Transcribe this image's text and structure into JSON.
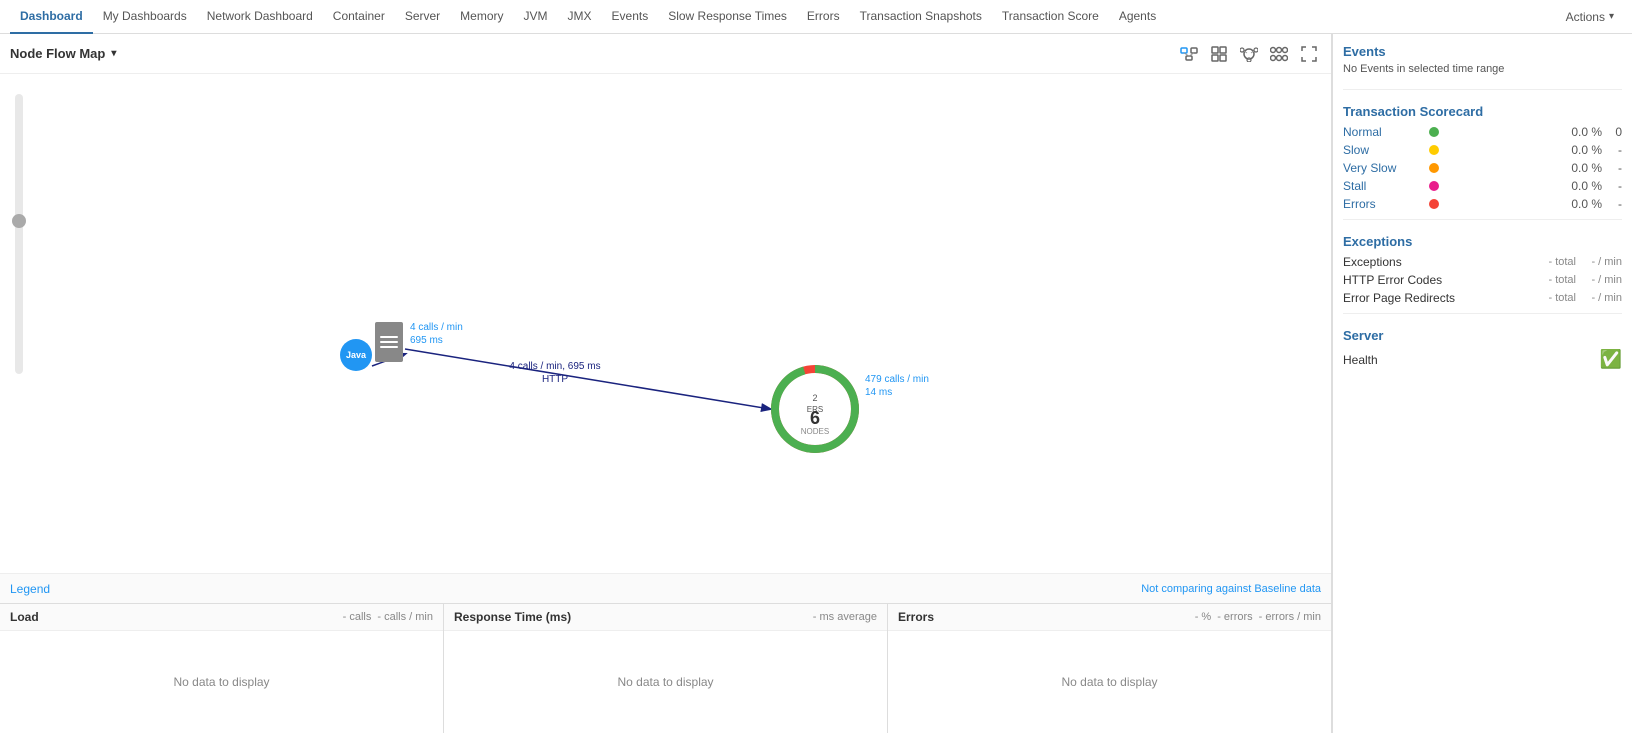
{
  "nav": {
    "tabs": [
      {
        "label": "Dashboard",
        "active": true
      },
      {
        "label": "My Dashboards",
        "active": false
      },
      {
        "label": "Network Dashboard",
        "active": false
      },
      {
        "label": "Container",
        "active": false
      },
      {
        "label": "Server",
        "active": false
      },
      {
        "label": "Memory",
        "active": false
      },
      {
        "label": "JVM",
        "active": false
      },
      {
        "label": "JMX",
        "active": false
      },
      {
        "label": "Events",
        "active": false
      },
      {
        "label": "Slow Response Times",
        "active": false
      },
      {
        "label": "Errors",
        "active": false
      },
      {
        "label": "Transaction Snapshots",
        "active": false
      },
      {
        "label": "Transaction Score",
        "active": false
      },
      {
        "label": "Agents",
        "active": false
      }
    ],
    "actions_label": "Actions"
  },
  "subheader": {
    "title": "Node Flow Map",
    "chevron": "▾"
  },
  "flow_map": {
    "java_node_label": "Java",
    "server_calls_label": "4 calls / min",
    "server_ms_label": "695 ms",
    "arrow_label_1": "4 calls / min, 695 ms",
    "arrow_label_2": "HTTP",
    "center_node": {
      "text_top": "2",
      "text_mid": "ERS",
      "text_num": "6",
      "text_bottom": "NODES"
    },
    "center_calls_label": "479 calls / min",
    "center_ms_label": "14 ms"
  },
  "legend": {
    "label": "Legend",
    "baseline_label": "Not comparing against Baseline data"
  },
  "bottom_panels": {
    "load": {
      "title": "Load",
      "meta_calls": "- calls",
      "meta_calls_min": "- calls / min",
      "no_data": "No data to display"
    },
    "response_time": {
      "title": "Response Time (ms)",
      "meta_avg": "- ms average",
      "no_data": "No data to display"
    },
    "errors": {
      "title": "Errors",
      "meta_pct": "- %",
      "meta_errors": "- errors",
      "meta_rate": "- errors / min",
      "no_data": "No data to display"
    }
  },
  "right_panel": {
    "events_title": "Events",
    "events_text": "No Events in selected time range",
    "scorecard_title": "Transaction Scorecard",
    "scorecard_rows": [
      {
        "label": "Normal",
        "color": "#4caf50",
        "pct": "0.0 %",
        "count": "0",
        "dash": ""
      },
      {
        "label": "Slow",
        "color": "#ffeb3b",
        "pct": "0.0 %",
        "count": "",
        "dash": "-"
      },
      {
        "label": "Very Slow",
        "color": "#ff9800",
        "pct": "0.0 %",
        "count": "",
        "dash": "-"
      },
      {
        "label": "Stall",
        "color": "#e91e8c",
        "pct": "0.0 %",
        "count": "",
        "dash": "-"
      },
      {
        "label": "Errors",
        "color": "#f44336",
        "pct": "0.0 %",
        "count": "",
        "dash": "-"
      }
    ],
    "exceptions_title": "Exceptions",
    "exceptions_rows": [
      {
        "label": "Exceptions",
        "total": "- total",
        "rate": "- / min"
      },
      {
        "label": "HTTP Error Codes",
        "total": "- total",
        "rate": "- / min"
      },
      {
        "label": "Error Page Redirects",
        "total": "- total",
        "rate": "- / min"
      }
    ],
    "server_title": "Server",
    "server_health_label": "Health"
  }
}
